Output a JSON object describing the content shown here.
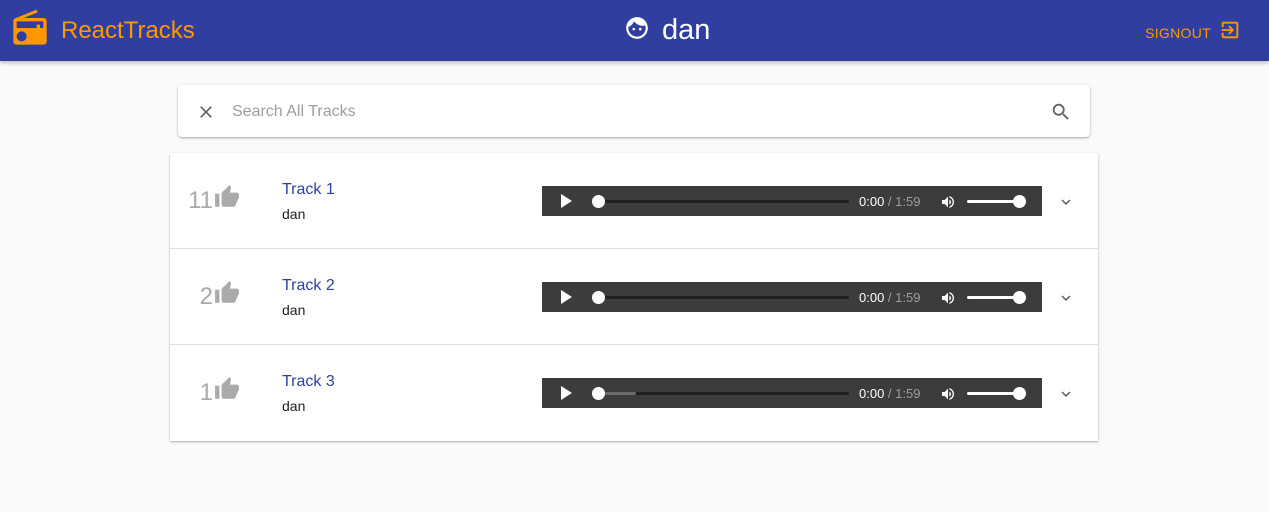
{
  "app": {
    "title": "ReactTracks",
    "brand_icon": "radio-icon",
    "brand_color": "#ff9800",
    "appbar_color": "#303f9f"
  },
  "user": {
    "name": "dan",
    "icon": "face-icon"
  },
  "signout": {
    "label": "SIGNOUT",
    "icon": "exit-icon"
  },
  "search": {
    "placeholder": "Search All Tracks",
    "value": "",
    "clear_icon": "close-icon",
    "submit_icon": "search-icon"
  },
  "tracks": [
    {
      "likes": "11",
      "title": "Track 1",
      "artist": "dan",
      "current_time": "0:00",
      "duration": "1:59",
      "progress": 0.0,
      "buffered": 0.0,
      "volume": 1.0
    },
    {
      "likes": "2",
      "title": "Track 2",
      "artist": "dan",
      "current_time": "0:00",
      "duration": "1:59",
      "progress": 0.0,
      "buffered": 0.0,
      "volume": 1.0
    },
    {
      "likes": "1",
      "title": "Track 3",
      "artist": "dan",
      "current_time": "0:00",
      "duration": "1:59",
      "progress": 0.0,
      "buffered": 0.17,
      "volume": 1.0
    }
  ]
}
